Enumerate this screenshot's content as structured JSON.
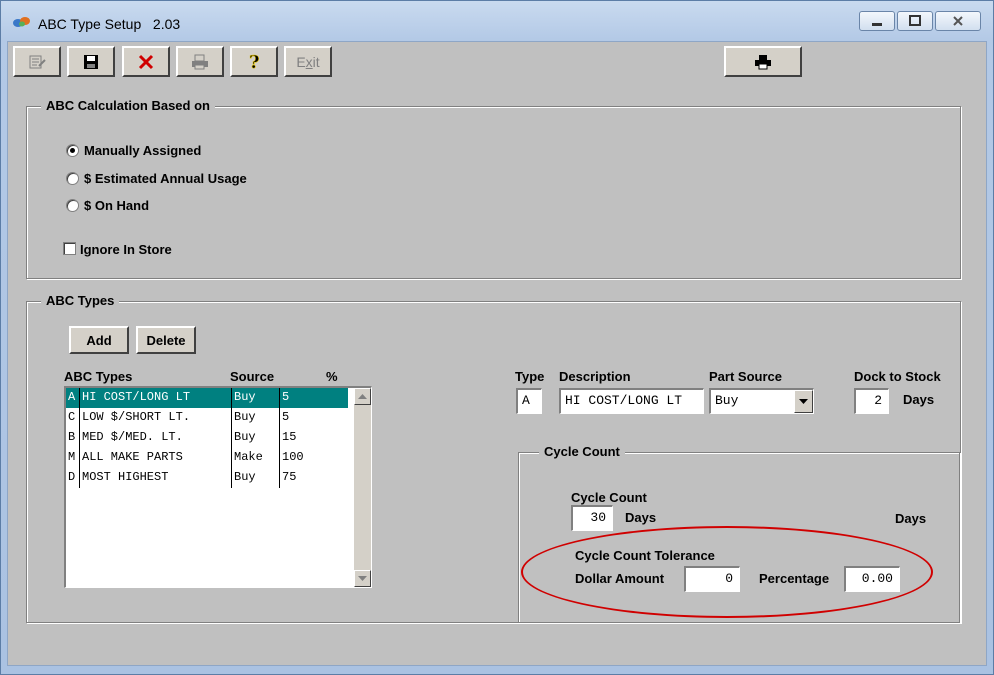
{
  "window": {
    "title": "ABC Type Setup",
    "version": "2.03"
  },
  "toolbar": {
    "exit_label": "Exit"
  },
  "calc_group": {
    "title": "ABC Calculation Based on",
    "options": [
      "Manually Assigned",
      "$ Estimated Annual Usage",
      "$ On Hand"
    ],
    "selected": "Manually Assigned",
    "ignore_in_store_label": "Ignore In Store",
    "ignore_in_store_checked": false
  },
  "types_group": {
    "title": "ABC Types",
    "add_label": "Add",
    "delete_label": "Delete",
    "list_headers": {
      "types": "ABC Types",
      "source": "Source",
      "pct": "%"
    },
    "rows": [
      {
        "code": "A",
        "description": "HI COST/LONG LT",
        "source": "Buy",
        "pct": "5",
        "selected": true
      },
      {
        "code": "C",
        "description": "LOW $/SHORT LT.",
        "source": "Buy",
        "pct": "5",
        "selected": false
      },
      {
        "code": "B",
        "description": "MED $/MED. LT.",
        "source": "Buy",
        "pct": "15",
        "selected": false
      },
      {
        "code": "M",
        "description": "ALL MAKE PARTS",
        "source": "Make",
        "pct": "100",
        "selected": false
      },
      {
        "code": "D",
        "description": "MOST HIGHEST",
        "source": "Buy",
        "pct": "75",
        "selected": false
      }
    ]
  },
  "detail": {
    "type_label": "Type",
    "type_value": "A",
    "description_label": "Description",
    "description_value": "HI COST/LONG LT",
    "part_source_label": "Part Source",
    "part_source_value": "Buy",
    "dock_label": "Dock to Stock",
    "dock_value": "2",
    "dock_unit": "Days"
  },
  "cycle_group": {
    "title": "Cycle Count",
    "cycle_count_label": "Cycle Count",
    "cycle_count_value": "30",
    "days_label": "Days",
    "days_label_right": "Days",
    "tolerance_label": "Cycle Count Tolerance",
    "dollar_label": "Dollar Amount",
    "dollar_value": "0",
    "percentage_label": "Percentage",
    "percentage_value": "0.00"
  },
  "colors": {
    "highlight": "#008080",
    "annotation": "#d00000",
    "face": "#c0c0c0"
  }
}
